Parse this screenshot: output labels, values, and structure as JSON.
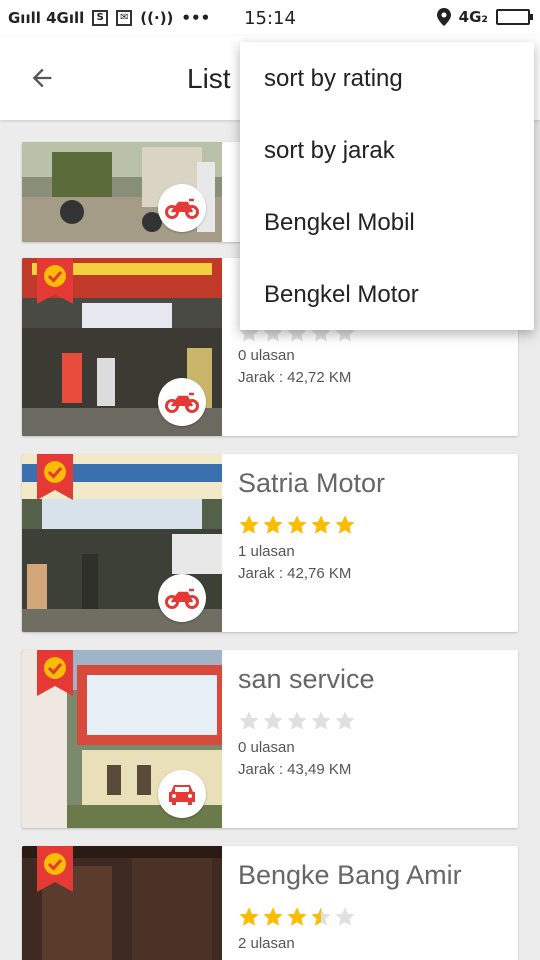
{
  "status_bar": {
    "signal_text": "Gııll 4Gıll",
    "time": "15:14",
    "network_badge": "4G₂",
    "icons": [
      "sim-icon",
      "mail-icon",
      "hotspot-icon",
      "more-icon",
      "location-icon",
      "battery-icon"
    ]
  },
  "app_bar": {
    "title": "List",
    "back_icon": "arrow-back-icon"
  },
  "menu": {
    "items": [
      {
        "label": "sort by rating"
      },
      {
        "label": "sort by jarak"
      },
      {
        "label": "Bengkel Mobil"
      },
      {
        "label": "Bengkel Motor"
      }
    ]
  },
  "colors": {
    "accent_red": "#e53935",
    "star_yellow": "#fbbc05",
    "star_gray": "#e0e0e0",
    "background": "#ececec"
  },
  "cards": [
    {
      "name": "",
      "rating": null,
      "reviews": "",
      "distance": "",
      "type": "motor",
      "verified": false
    },
    {
      "name": "",
      "rating": 0,
      "reviews": "0 ulasan",
      "distance": "Jarak : 42,72 KM",
      "type": "motor",
      "verified": true
    },
    {
      "name": "Satria Motor",
      "rating": 5,
      "reviews": "1 ulasan",
      "distance": "Jarak : 42,76 KM",
      "type": "motor",
      "verified": true
    },
    {
      "name": "san service",
      "rating": 0,
      "reviews": "0 ulasan",
      "distance": "Jarak : 43,49 KM",
      "type": "mobil",
      "verified": true
    },
    {
      "name": "Bengke Bang Amir",
      "rating": 3.5,
      "reviews": "2 ulasan",
      "distance": "",
      "type": "motor",
      "verified": true
    }
  ]
}
